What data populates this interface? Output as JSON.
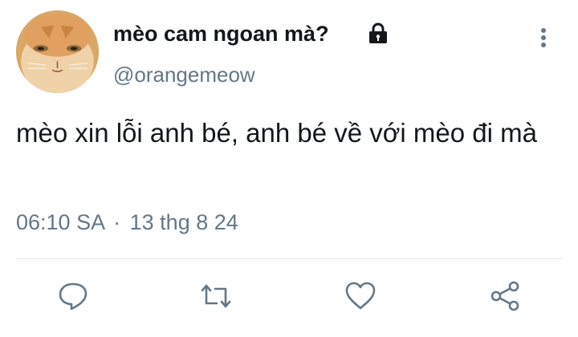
{
  "tweet": {
    "display_name": "mèo cam ngoan mà?",
    "handle": "@orangemeow",
    "text": "mèo xin lỗi anh bé, anh bé về với mèo đi mà",
    "time": "06:10 SA",
    "separator": "·",
    "date": "13 thg 8 24"
  },
  "icons": {
    "lock": "lock-icon",
    "more": "more-vertical-icon",
    "reply": "reply-icon",
    "retweet": "retweet-icon",
    "like": "heart-icon",
    "share": "share-icon"
  },
  "colors": {
    "text": "#14171a",
    "secondary": "#657786",
    "icon": "#657786",
    "divider": "#e1e8ed"
  }
}
